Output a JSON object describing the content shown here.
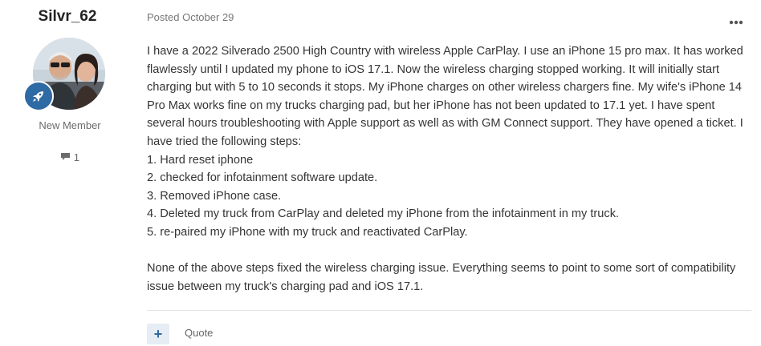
{
  "author": {
    "username": "Silvr_62",
    "member_title": "New Member",
    "post_count": "1",
    "avatar_icon": "user-avatar-photo",
    "rank_icon": "rocket-icon",
    "rank_color": "#2e6aa3"
  },
  "post": {
    "posted_label": "Posted October 29",
    "options_icon": "ellipsis-icon",
    "paragraph_intro": "I have a 2022 Silverado 2500 High Country with wireless Apple CarPlay. I use an iPhone 15 pro max. It has worked flawlessly until I updated my phone to iOS 17.1. Now the wireless charging stopped working. It will initially start charging but with 5 to 10 seconds it stops. My iPhone charges on other wireless chargers fine. My wife's iPhone 14 Pro Max works fine on my trucks charging pad, but her iPhone has not been updated to 17.1 yet. I have spent several hours troubleshooting with Apple support as well as with GM Connect support. They have opened a ticket. I have tried the following steps:",
    "steps": [
      "1. Hard reset iphone",
      "2. checked for infotainment software update.",
      "3. Removed iPhone case.",
      "4. Deleted my truck from CarPlay and deleted my iPhone from the infotainment in my truck.",
      "5. re-paired my iPhone with my truck and reactivated CarPlay."
    ],
    "paragraph_conclusion": "None of the above steps fixed the wireless charging issue. Everything seems to point to some sort of compatibility issue between my truck's charging pad and iOS 17.1."
  },
  "actions": {
    "multiquote_label": "+",
    "quote_label": "Quote"
  }
}
